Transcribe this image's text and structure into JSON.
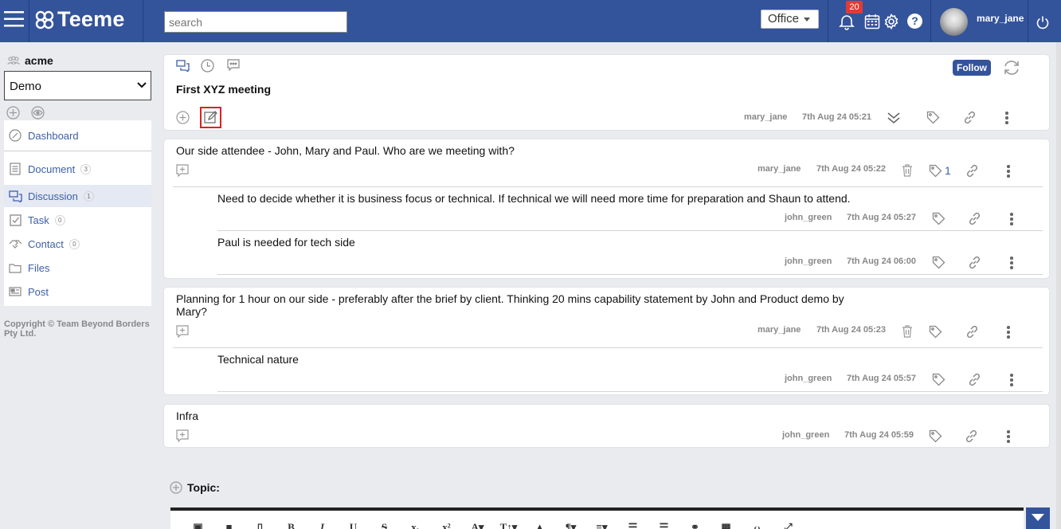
{
  "topbar": {
    "brand": "Teeme",
    "search_placeholder": "search",
    "office_label": "Office",
    "notification_count": "20",
    "help_label": "?",
    "username": "mary_jane"
  },
  "sidebar": {
    "org_name": "acme",
    "space_selected": "Demo",
    "nav": [
      {
        "label": "Dashboard",
        "count": "",
        "icon": "dashboard-icon"
      },
      {
        "label": "Document",
        "count": "3",
        "icon": "document-icon"
      },
      {
        "label": "Discussion",
        "count": "1",
        "icon": "discussion-icon"
      },
      {
        "label": "Task",
        "count": "0",
        "icon": "task-icon"
      },
      {
        "label": "Contact",
        "count": "0",
        "icon": "contact-icon"
      },
      {
        "label": "Files",
        "count": "",
        "icon": "files-icon"
      },
      {
        "label": "Post",
        "count": "",
        "icon": "post-icon"
      }
    ],
    "copyright": "Copyright © Team Beyond Borders Pty Ltd."
  },
  "discussion": {
    "title": "First XYZ meeting",
    "follow_label": "Follow",
    "author": "mary_jane",
    "timestamp": "7th Aug 24 05:21"
  },
  "posts": [
    {
      "text": "Our side attendee - John, Mary and Paul. Who are we meeting with?",
      "author": "mary_jane",
      "timestamp": "7th Aug 24 05:22",
      "tag_count": "1",
      "replies": [
        {
          "text": "Need to decide whether it is business focus or technical. If technical we will need more time for preparation and Shaun to attend.",
          "author": "john_green",
          "timestamp": "7th Aug 24 05:27"
        },
        {
          "text": "Paul is needed for tech side",
          "author": "john_green",
          "timestamp": "7th Aug 24 06:00"
        }
      ]
    },
    {
      "text": "Planning for 1 hour on our side - preferably after the brief by client. Thinking 20 mins capability statement by John and Product demo by Mary?",
      "author": "mary_jane",
      "timestamp": "7th Aug 24 05:23",
      "replies": [
        {
          "text": "Technical nature",
          "author": "john_green",
          "timestamp": "7th Aug 24 05:57"
        }
      ]
    },
    {
      "text": "Infra",
      "author": "john_green",
      "timestamp": "7th Aug 24 05:59",
      "replies": []
    }
  ],
  "topic": {
    "label": "Topic:"
  },
  "editor": {
    "tools": [
      "image-icon",
      "video-icon",
      "file-icon",
      "B",
      "I",
      "U",
      "S",
      "x₂",
      "x²",
      "A▾",
      "T↕▾",
      "fill-icon",
      "¶▾",
      "≡▾",
      "ordered-list-icon",
      "unordered-list-icon",
      "link-icon",
      "table-icon",
      "code-icon",
      "fullscreen-icon"
    ]
  },
  "colors": {
    "brand": "#33539b",
    "highlight": "#e02020",
    "badge": "#e53935"
  }
}
